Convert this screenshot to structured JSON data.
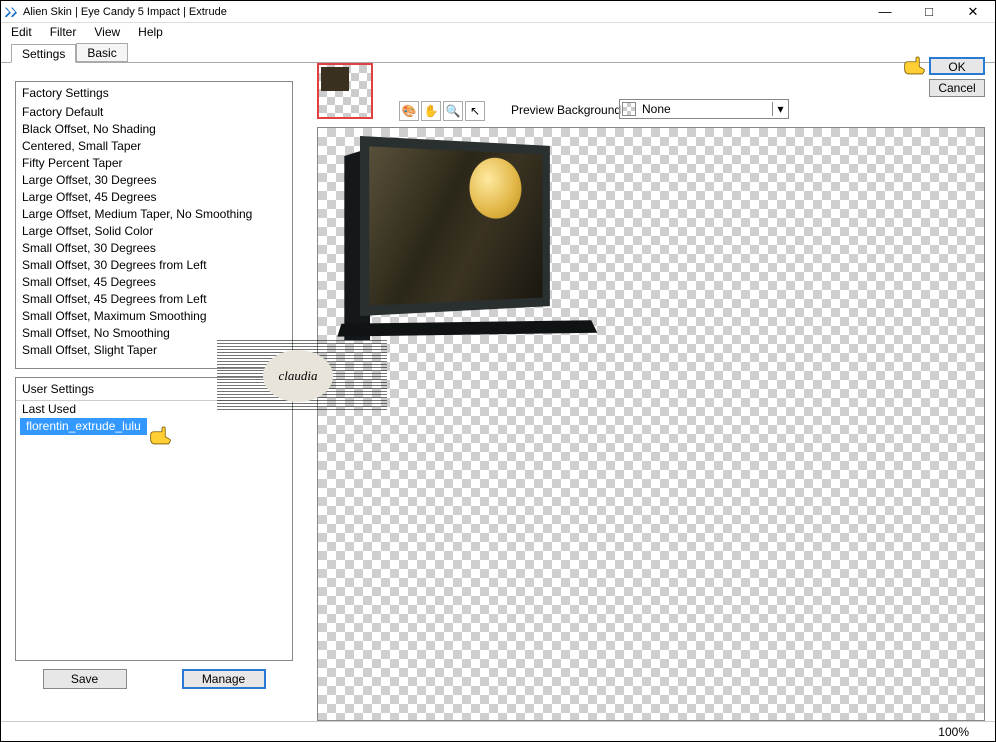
{
  "window": {
    "title": "Alien Skin | Eye Candy 5 Impact | Extrude",
    "min": "—",
    "max": "□",
    "close": "✕"
  },
  "menus": [
    "Edit",
    "Filter",
    "View",
    "Help"
  ],
  "tabs": {
    "settings": "Settings",
    "basic": "Basic"
  },
  "factory": {
    "header": "Factory Settings",
    "items": [
      "Factory Default",
      "Black Offset, No Shading",
      "Centered, Small Taper",
      "Fifty Percent Taper",
      "Large Offset, 30 Degrees",
      "Large Offset, 45 Degrees",
      "Large Offset, Medium Taper, No Smoothing",
      "Large Offset, Solid Color",
      "Small Offset, 30 Degrees",
      "Small Offset, 30 Degrees from Left",
      "Small Offset, 45 Degrees",
      "Small Offset, 45 Degrees from Left",
      "Small Offset, Maximum Smoothing",
      "Small Offset, No Smoothing",
      "Small Offset, Slight Taper"
    ]
  },
  "user": {
    "header": "User Settings",
    "items": [
      "Last Used",
      "florentin_extrude_lulu"
    ],
    "selected_index": 1
  },
  "buttons": {
    "save": "Save",
    "manage": "Manage",
    "ok": "OK",
    "cancel": "Cancel"
  },
  "preview_bg": {
    "label": "Preview Background:",
    "value": "None"
  },
  "tooltips": {
    "pan": "✋",
    "zoom": "🔍",
    "pointer": "↖",
    "color": "🎨"
  },
  "watermark": "claudia",
  "status": {
    "zoom": "100%"
  }
}
